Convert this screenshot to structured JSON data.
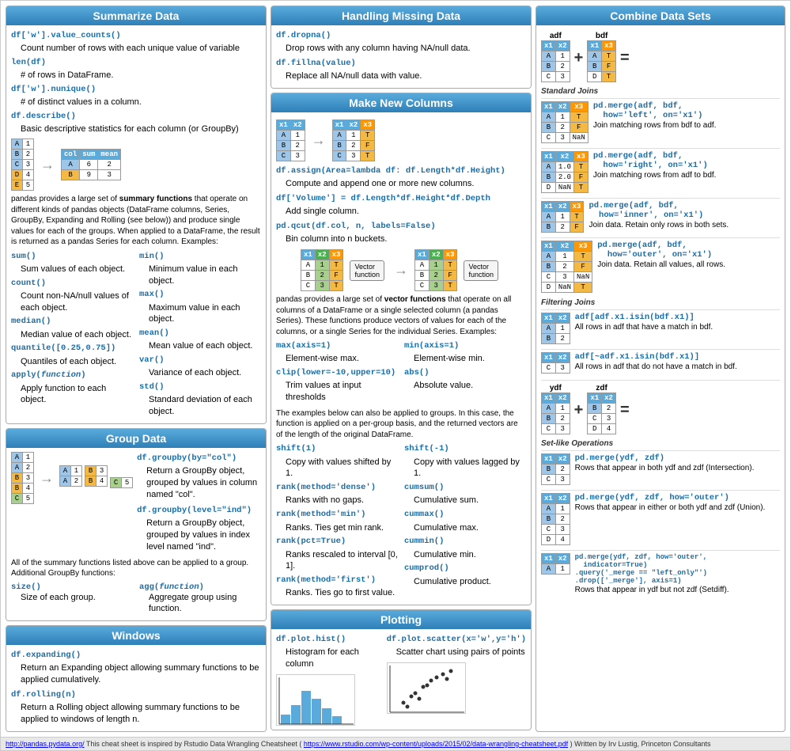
{
  "sections": {
    "summarize": {
      "title": "Summarize Data",
      "code_lines": [
        "df['w'].value_counts()",
        "len(df)",
        "df['w'].nunique()",
        "df.describe()"
      ],
      "descriptions": [
        "Count number of rows with each unique value of variable",
        "# of rows in DataFrame.",
        "# of distinct values in a column.",
        "Basic descriptive statistics for each column (or GroupBy)"
      ],
      "summary_text": "pandas provides a large set of summary functions that operate on different kinds of pandas objects (DataFrame columns, Series, GroupBy, Expanding and Rolling (see below)) and produce single values for each of the groups. When applied to a DataFrame, the result is returned as a pandas Series for each column. Examples:",
      "functions": [
        {
          "name": "sum()",
          "desc": "Sum values of each object."
        },
        {
          "name": "count()",
          "desc": "Count non-NA/null values of each object."
        },
        {
          "name": "median()",
          "desc": "Median value of each object."
        },
        {
          "name": "quantile([0.25,0.75])",
          "desc": "Quantiles of each object."
        },
        {
          "name": "apply(function)",
          "desc": "Apply function to each object."
        },
        {
          "name": "min()",
          "desc": "Minimum value in each object."
        },
        {
          "name": "max()",
          "desc": "Maximum value in each object."
        },
        {
          "name": "mean()",
          "desc": "Mean value of each object."
        },
        {
          "name": "var()",
          "desc": "Variance of each object."
        },
        {
          "name": "std()",
          "desc": "Standard deviation of each object."
        }
      ]
    },
    "group": {
      "title": "Group Data",
      "code1": "df.groupby(by=\"col\")",
      "desc1": "Return a GroupBy object, grouped by values in column named \"col\".",
      "code2": "df.groupby(level=\"ind\")",
      "desc2": "Return a GroupBy object, grouped by values in index level named \"ind\".",
      "summary_text": "All of the summary functions listed above can be applied to a group. Additional GroupBy functions:",
      "code3": "size()",
      "desc3": "Size of each group.",
      "code4": "agg(function)",
      "desc4": "Aggregate group using function."
    },
    "windows": {
      "title": "Windows",
      "code1": "df.expanding()",
      "desc1": "Return an Expanding object allowing summary functions to be applied cumulatively.",
      "code2": "df.rolling(n)",
      "desc2": "Return a Rolling object allowing summary functions to be applied to windows of length n."
    },
    "missing": {
      "title": "Handling Missing Data",
      "code1": "df.dropna()",
      "desc1": "Drop rows with any column having NA/null data.",
      "code2": "df.fillna(value)",
      "desc2": "Replace all NA/null data with value."
    },
    "new_columns": {
      "title": "Make New Columns",
      "code1": "df.assign(Area=lambda df: df.Length*df.Height)",
      "desc1": "Compute and append one or more new columns.",
      "code2": "df['Volume'] = df.Length*df.Height*df.Depth",
      "desc2": "Add single column.",
      "code3": "pd.qcut(df.col, n, labels=False)",
      "desc3": "Bin column into n buckets.",
      "vector_text": "pandas provides a large set of vector functions that operate on all columns of a DataFrame or a single selected column (a pandas Series). These functions produce vectors of values for each of the columns, or a single Series for the individual Series. Examples:",
      "functions": [
        {
          "name": "max(axis=1)",
          "desc": "Element-wise max."
        },
        {
          "name": "min(axis=1)",
          "desc": "Element-wise min."
        },
        {
          "name": "clip(lower=-10,upper=10)",
          "desc": "Trim values at input thresholds"
        },
        {
          "name": "abs()",
          "desc": "Absolute value."
        }
      ],
      "group_text": "The examples below can also be applied to groups. In this case, the function is applied on a per-group basis, and the returned vectors are of the length of the original DataFrame.",
      "shift_functions": [
        {
          "name": "shift(1)",
          "desc": "Copy with values shifted by 1."
        },
        {
          "name": "shift(-1)",
          "desc": "Copy with values lagged by 1."
        },
        {
          "name": "rank(method='dense')",
          "desc": "Ranks with no gaps."
        },
        {
          "name": "cumsum()",
          "desc": "Cumulative sum."
        },
        {
          "name": "rank(method='min')",
          "desc": "Ranks. Ties get min rank."
        },
        {
          "name": "cummax()",
          "desc": "Cumulative max."
        },
        {
          "name": "rank(pct=True)",
          "desc": "Ranks rescaled to interval [0, 1]."
        },
        {
          "name": "cummin()",
          "desc": "Cumulative min."
        },
        {
          "name": "rank(method='first')",
          "desc": "Ranks. Ties go to first value."
        },
        {
          "name": "cumprod()",
          "desc": "Cumulative product."
        }
      ]
    },
    "plotting": {
      "title": "Plotting",
      "code1": "df.plot.hist()",
      "desc1": "Histogram for each column",
      "code2": "df.plot.scatter(x='w',y='h')",
      "desc2": "Scatter chart using pairs of points"
    },
    "combine": {
      "title": "Combine Data Sets",
      "standard_joins_label": "Standard Joins",
      "filtering_joins_label": "Filtering Joins",
      "set_ops_label": "Set-like Operations",
      "joins": [
        {
          "code": "pd.merge(adf, bdf,\n  how='left', on='x1')",
          "desc": "Join matching rows from bdf to adf."
        },
        {
          "code": "pd.merge(adf, bdf,\n  how='right', on='x1')",
          "desc": "Join matching rows from adf to bdf."
        },
        {
          "code": "pd.merge(adf, bdf,\n  how='inner', on='x1')",
          "desc": "Join data. Retain only rows in both sets."
        },
        {
          "code": "pd.merge(adf, bdf,\n  how='outer', on='x1')",
          "desc": "Join data. Retain all values, all rows."
        }
      ],
      "filter_joins": [
        {
          "code": "adf[adf.x1.isin(bdf.x1)]",
          "desc": "All rows in adf that have a match in bdf."
        },
        {
          "code": "adf[~adf.x1.isin(bdf.x1)]",
          "desc": "All rows in adf that do not have a match in bdf."
        }
      ],
      "set_ops": [
        {
          "code": "pd.merge(ydf, zdf)",
          "desc": "Rows that appear in both ydf and zdf\n(Intersection)."
        },
        {
          "code": "pd.merge(ydf, zdf, how='outer')",
          "desc": "Rows that appear in either or both ydf and zdf\n(Union)."
        },
        {
          "code": "pd.merge(ydf, zdf, how='outer',\n  indicator=True)\n.query('_merge == \"left_only\"')\n.drop(['_merge'], axis=1)",
          "desc": "Rows that appear in ydf but not zdf (Setdiff)."
        }
      ]
    }
  },
  "footer": {
    "link1_text": "http://pandas.pydata.org/",
    "main_text": "This cheat sheet is inspired by Rstudio Data Wrangling Cheatsheet (",
    "link2_text": "https://www.rstudio.com/wp-content/uploads/2015/02/data-wrangling-cheatsheet.pdf",
    "end_text": ") Written by Irv Lustig, Princeton Consultants"
  }
}
